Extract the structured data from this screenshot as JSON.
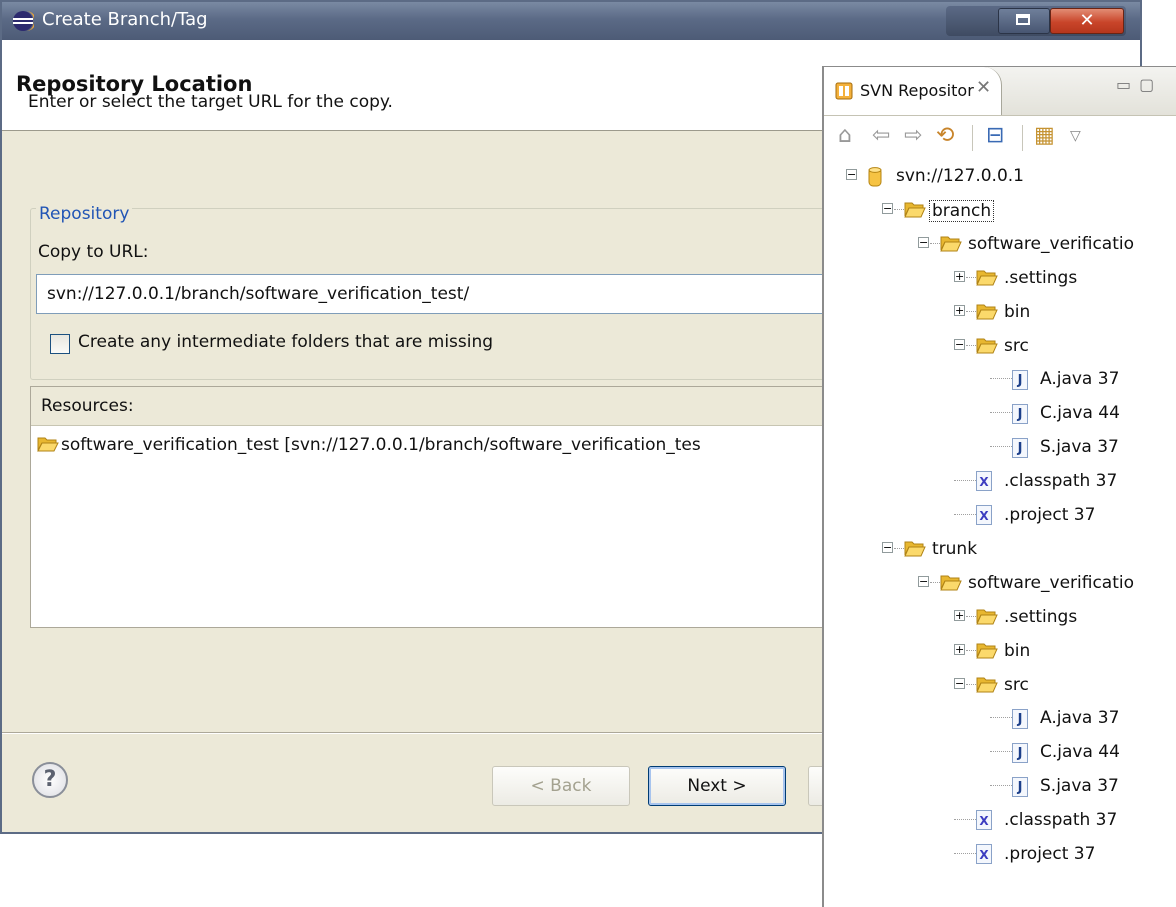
{
  "dialog": {
    "title": "Create Branch/Tag",
    "heading": "Repository Location",
    "description": "Enter or select the target URL for the copy.",
    "group_label": "Repository",
    "copy_to_url_label": "Copy to URL:",
    "copy_to_url_value": "svn://127.0.0.1/branch/software_verification_test/",
    "create_missing_label": "Create any intermediate folders that are missing",
    "resources_header": "Resources:",
    "resources": [
      "software_verification_test [svn://127.0.0.1/branch/software_verification_tes"
    ],
    "help_label": "?",
    "back_label": "< Back",
    "next_label": "Next >"
  },
  "svn_view": {
    "title": "SVN Repositor",
    "tree": [
      {
        "label": "svn://127.0.0.1",
        "icon": "repository-icon",
        "expanded": true
      },
      {
        "label": "branch",
        "icon": "folder-icon",
        "expanded": true,
        "selected": true
      },
      {
        "label": "software_verificatio",
        "icon": "folder-icon",
        "expanded": true
      },
      {
        "label": ".settings",
        "icon": "folder-icon",
        "expanded": false
      },
      {
        "label": "bin",
        "icon": "folder-icon",
        "expanded": false
      },
      {
        "label": "src",
        "icon": "folder-icon",
        "expanded": true
      },
      {
        "label": "A.java 37",
        "icon": "java-file-icon"
      },
      {
        "label": "C.java 44",
        "icon": "java-file-icon"
      },
      {
        "label": "S.java 37",
        "icon": "java-file-icon"
      },
      {
        "label": ".classpath 37",
        "icon": "xml-file-icon"
      },
      {
        "label": ".project 37",
        "icon": "xml-file-icon"
      },
      {
        "label": "trunk",
        "icon": "folder-icon",
        "expanded": true
      },
      {
        "label": "software_verificatio",
        "icon": "folder-icon",
        "expanded": true
      },
      {
        "label": ".settings",
        "icon": "folder-icon",
        "expanded": false
      },
      {
        "label": "bin",
        "icon": "folder-icon",
        "expanded": false
      },
      {
        "label": "src",
        "icon": "folder-icon",
        "expanded": true
      },
      {
        "label": "A.java 37",
        "icon": "java-file-icon"
      },
      {
        "label": "C.java 44",
        "icon": "java-file-icon"
      },
      {
        "label": "S.java 37",
        "icon": "java-file-icon"
      },
      {
        "label": ".classpath 37",
        "icon": "xml-file-icon"
      },
      {
        "label": ".project 37",
        "icon": "xml-file-icon"
      }
    ]
  },
  "colors": {
    "accent": "#2155b5",
    "title_bar": "#5b6a86",
    "folder": "#f6c343"
  }
}
